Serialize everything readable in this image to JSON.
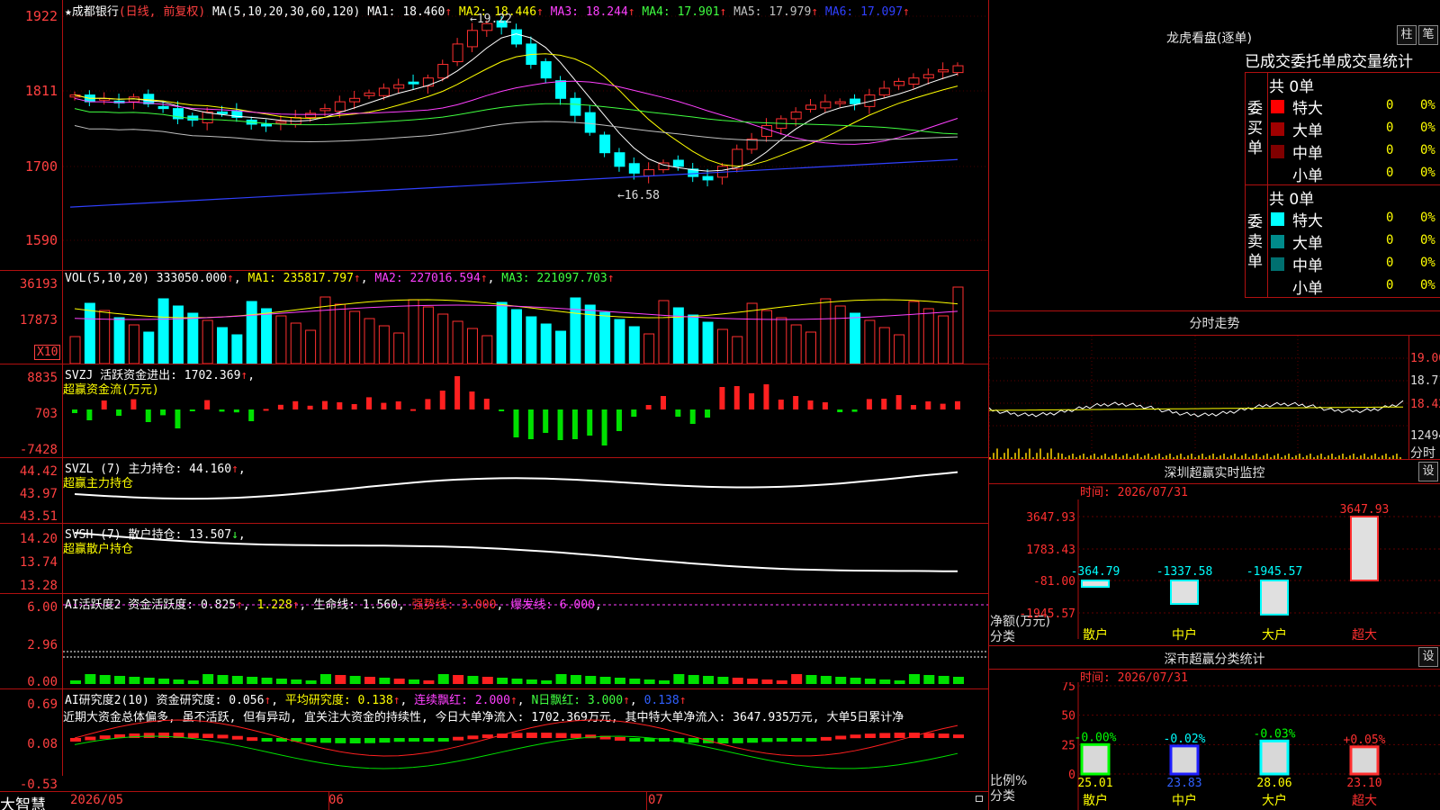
{
  "window": {
    "app_name": "大智慧",
    "title_prefix": "★",
    "stock_name": "成都银行",
    "period_note": "(日线, 前复权)"
  },
  "main_chart": {
    "ma_header": "MA(5,10,20,30,60,120)",
    "ma_values": [
      {
        "label": "MA1: 18.460",
        "color": "#ffffff"
      },
      {
        "label": "MA2: 18.446",
        "color": "#ffff00"
      },
      {
        "label": "MA3: 18.244",
        "color": "#ff40ff"
      },
      {
        "label": "MA4: 17.901",
        "color": "#40ff40"
      },
      {
        "label": "MA5: 17.979",
        "color": "#c0c0c0"
      },
      {
        "label": "MA6: 17.097",
        "color": "#3040ff"
      }
    ],
    "y_ticks": [
      "1922",
      "1811",
      "1700",
      "1590"
    ],
    "high_label": "←19.22",
    "low_label": "←16.58"
  },
  "volume": {
    "header": "VOL(5,10,20)",
    "value": "333050.000",
    "ma1": "MA1: 235817.797",
    "ma2": "MA2: 227016.594",
    "ma3": "MA3: 221097.703",
    "y_ticks": [
      "36193",
      "17873"
    ],
    "unit": "X10"
  },
  "svzj": {
    "header": "SVZJ  活跃资金进出: 1702.369",
    "sub": "超赢资金流(万元)",
    "y_ticks": [
      "8835",
      "703",
      "-7428"
    ]
  },
  "svzl": {
    "header": "SVZL (7) 主力持仓: 44.160",
    "sub": "超赢主力持仓",
    "y_ticks": [
      "44.42",
      "43.97",
      "43.51"
    ]
  },
  "svsh": {
    "header": "SVSH (7) 散户持仓: 13.507",
    "sub": "超赢散户持仓",
    "y_ticks": [
      "14.20",
      "13.74",
      "13.28"
    ]
  },
  "ai_active": {
    "header": "AI活跃度2 资金活跃度: 0.825",
    "v2": "1.228",
    "life": "生命线: 1.560",
    "strong": "强势线: 3.000",
    "burst": "爆发线: 6.000",
    "y_ticks": [
      "6.00",
      "2.96",
      "0.00"
    ]
  },
  "ai_research": {
    "header": "AI研究度2(10) 资金研究度: 0.056",
    "avg": "平均研究度: 0.138",
    "cont": "连续飘红: 2.000",
    "nday": "N日飘红: 3.000",
    "last": "0.138",
    "comment": "近期大资金总体偏多, 虽不活跃, 但有异动, 宜关注大资金的持续性, 今日大单净流入: 1702.369万元, 其中特大单净流入: 3647.935万元, 大单5日累计净",
    "y_ticks": [
      "0.69",
      "0.08",
      "-0.53"
    ]
  },
  "date_axis": [
    "2026/05",
    "06",
    "07"
  ],
  "order_panel": {
    "title": "龙虎看盘(逐单)",
    "btn_bar": "柱",
    "btn_pen": "笔",
    "tabs": [
      "已成交",
      "委托单",
      "成交量统计"
    ],
    "buy": {
      "label": "委买单",
      "count": "共 0单",
      "rows": [
        {
          "name": "特大",
          "count": "0",
          "pct": "0%",
          "color": "#ff0000"
        },
        {
          "name": "大单",
          "count": "0",
          "pct": "0%",
          "color": "#a00000"
        },
        {
          "name": "中单",
          "count": "0",
          "pct": "0%",
          "color": "#800000"
        },
        {
          "name": "小单",
          "count": "0",
          "pct": "0%",
          "color": "#000000"
        }
      ]
    },
    "sell": {
      "label": "委卖单",
      "count": "共 0单",
      "rows": [
        {
          "name": "特大",
          "count": "0",
          "pct": "0%",
          "color": "#00ffff"
        },
        {
          "name": "大单",
          "count": "0",
          "pct": "0%",
          "color": "#008b8b"
        },
        {
          "name": "中单",
          "count": "0",
          "pct": "0%",
          "color": "#007070"
        },
        {
          "name": "小单",
          "count": "0",
          "pct": "0%",
          "color": "#000000"
        }
      ]
    }
  },
  "intraday": {
    "title": "分时走势",
    "y_ticks": [
      "19.00",
      "18.71",
      "18.42",
      "12494"
    ],
    "x_label": "分时"
  },
  "monitor": {
    "title": "深圳超赢实时监控",
    "btn": "设",
    "time": "时间: 2026/07/31",
    "y_ticks": [
      "3647.93",
      "1783.43",
      "-81.00",
      "-1945.57"
    ],
    "y_label": "净额(万元)",
    "x_label": "分类",
    "chart_data": {
      "type": "bar",
      "categories": [
        "散户",
        "中户",
        "大户",
        "超大"
      ],
      "values": [
        -364.79,
        -1337.58,
        -1945.57,
        3647.93
      ],
      "ylim": [
        -1945.57,
        3647.93
      ]
    }
  },
  "stats": {
    "title": "深市超赢分类统计",
    "btn": "设",
    "time": "时间: 2026/07/31",
    "y_ticks": [
      "75",
      "50",
      "25",
      "0"
    ],
    "y_label": "比例%",
    "x_label": "分类",
    "chart_data": {
      "type": "bar",
      "categories": [
        "散户",
        "中户",
        "大户",
        "超大"
      ],
      "values": [
        25.01,
        23.83,
        28.06,
        23.1
      ],
      "changes": [
        "-0.00%",
        "-0.02%",
        "-0.03%",
        "+0.05%"
      ],
      "ylim": [
        0,
        75
      ]
    }
  }
}
